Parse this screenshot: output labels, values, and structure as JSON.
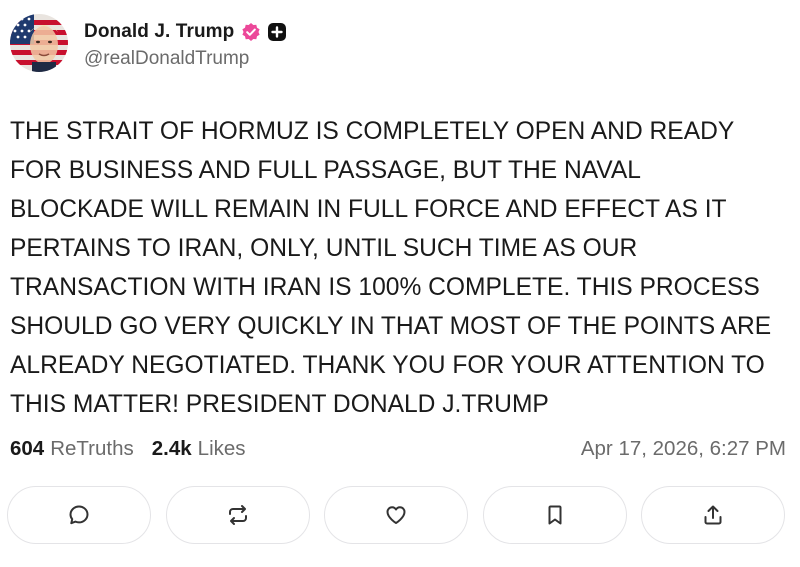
{
  "author": {
    "display_name": "Donald J. Trump",
    "handle": "@realDonaldTrump",
    "verified_color": "#ec4899"
  },
  "post": {
    "text": "THE STRAIT OF HORMUZ IS COMPLETELY OPEN AND READY\nFOR BUSINESS AND FULL PASSAGE, BUT THE NAVAL\nBLOCKADE WILL REMAIN IN FULL FORCE AND EFFECT AS IT\nPERTAINS TO IRAN, ONLY, UNTIL SUCH TIME AS OUR\nTRANSACTION WITH IRAN IS 100% COMPLETE. THIS PROCESS\nSHOULD GO VERY QUICKLY IN THAT MOST OF THE POINTS ARE\nALREADY NEGOTIATED. THANK YOU FOR YOUR ATTENTION TO\nTHIS MATTER! PRESIDENT DONALD J.TRUMP",
    "retruths_count": "604",
    "retruths_label": "ReTruths",
    "likes_count": "2.4k",
    "likes_label": "Likes",
    "timestamp": "Apr 17, 2026, 6:27 PM"
  },
  "actions": [
    {
      "icon": "reply-icon"
    },
    {
      "icon": "retruth-icon"
    },
    {
      "icon": "heart-icon"
    },
    {
      "icon": "bookmark-icon"
    },
    {
      "icon": "share-icon"
    }
  ]
}
